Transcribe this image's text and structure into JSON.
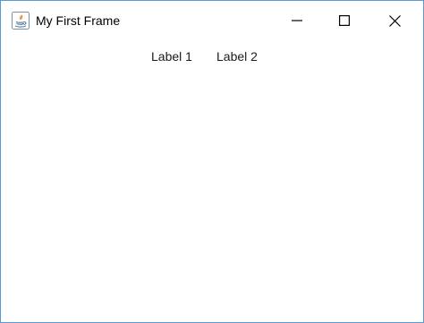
{
  "window": {
    "title": "My First Frame",
    "app_icon": "java-icon",
    "controls": {
      "minimize_icon": "minimize-icon",
      "maximize_icon": "maximize-icon",
      "close_icon": "close-icon"
    },
    "border_color": "#5b9bd5"
  },
  "content": {
    "labels": [
      {
        "text": "Label 1"
      },
      {
        "text": "Label 2"
      }
    ]
  }
}
